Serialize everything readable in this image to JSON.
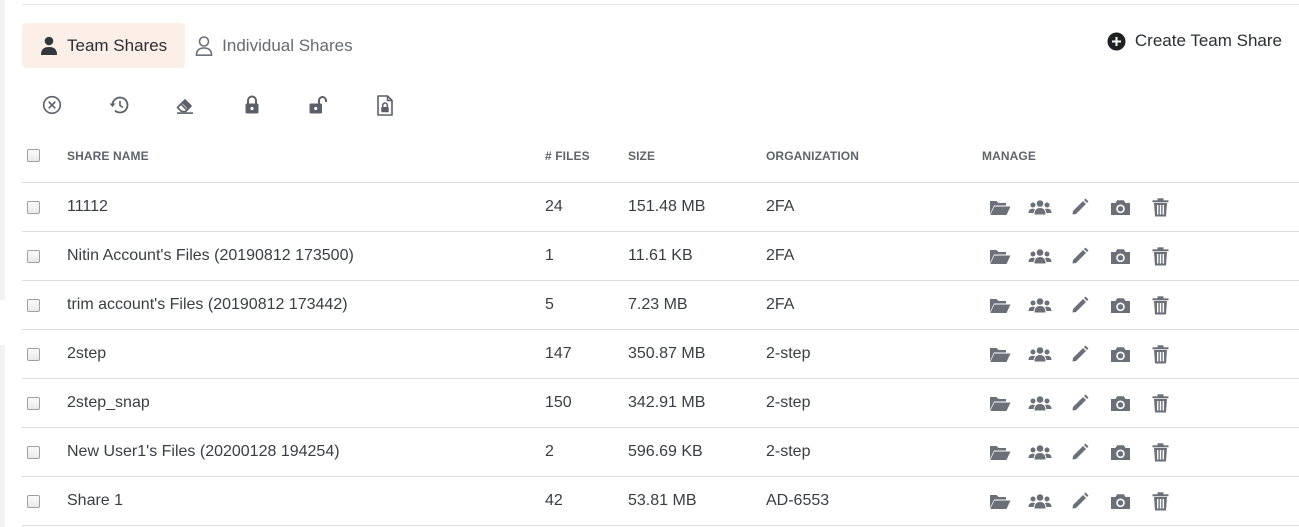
{
  "tabs": {
    "team_label": "Team Shares",
    "individual_label": "Individual Shares"
  },
  "actions": {
    "create_label": "Create Team Share"
  },
  "toolbar_icons": [
    "cancel-icon",
    "history-icon",
    "eraser-icon",
    "lock-icon",
    "unlock-icon",
    "file-lock-icon"
  ],
  "table": {
    "headers": {
      "name": "SHARE NAME",
      "files": "# FILES",
      "size": "SIZE",
      "org": "ORGANIZATION",
      "manage": "MANAGE"
    },
    "rows": [
      {
        "name": "11112",
        "files": "24",
        "size": "151.48 MB",
        "org": "2FA"
      },
      {
        "name": "Nitin Account's Files (20190812 173500)",
        "files": "1",
        "size": "11.61 KB",
        "org": "2FA"
      },
      {
        "name": "trim account's Files (20190812 173442)",
        "files": "5",
        "size": "7.23 MB",
        "org": "2FA"
      },
      {
        "name": "2step",
        "files": "147",
        "size": "350.87 MB",
        "org": "2-step"
      },
      {
        "name": "2step_snap",
        "files": "150",
        "size": "342.91 MB",
        "org": "2-step"
      },
      {
        "name": "New User1's Files (20200128 194254)",
        "files": "2",
        "size": "596.69 KB",
        "org": "2-step"
      },
      {
        "name": "Share 1",
        "files": "42",
        "size": "53.81 MB",
        "org": "AD-6553"
      }
    ]
  },
  "colors": {
    "active_tab_bg": "#fcefe7",
    "icon_gray": "#6b7078",
    "text": "#3a3d42"
  }
}
